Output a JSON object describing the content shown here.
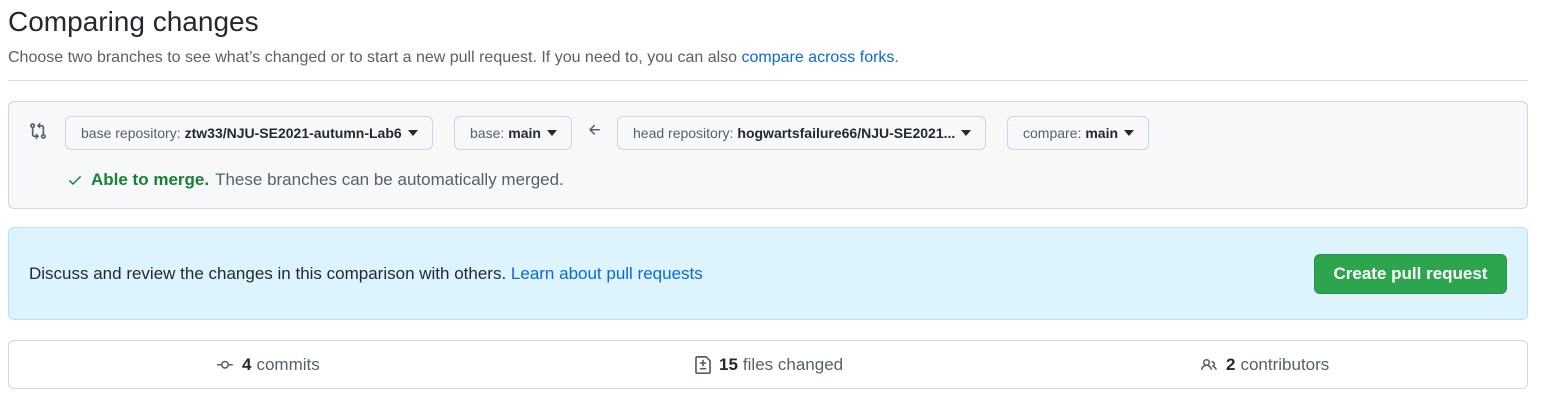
{
  "header": {
    "title": "Comparing changes",
    "subtitle": "Choose two branches to see what’s changed or to start a new pull request. If you need to, you can also ",
    "subtitle_link": "compare across forks",
    "subtitle_end": "."
  },
  "range": {
    "base_repo_label": "base repository:",
    "base_repo_value": "ztw33/NJU-SE2021-autumn-Lab6",
    "base_label": "base:",
    "base_value": "main",
    "head_repo_label": "head repository:",
    "head_repo_value": "hogwartsfailure66/NJU-SE2021...",
    "compare_label": "compare:",
    "compare_value": "main",
    "merge_status": "Able to merge.",
    "merge_text": "These branches can be automatically merged."
  },
  "flash": {
    "text": "Discuss and review the changes in this comparison with others. ",
    "link": "Learn about pull requests",
    "button": "Create pull request"
  },
  "summary": {
    "commits_count": "4",
    "commits_label": "commits",
    "files_count": "15",
    "files_label": "files changed",
    "contributors_count": "2",
    "contributors_label": "contributors"
  },
  "colors": {
    "accent_link": "#0969da",
    "success": "#1a7f37",
    "primary_button": "#2da44e",
    "flash_bg": "#ddf4ff"
  },
  "icons": [
    "git-compare-icon",
    "arrow-left-icon",
    "check-icon",
    "commit-icon",
    "file-diff-icon",
    "people-icon",
    "caret-down-icon"
  ]
}
